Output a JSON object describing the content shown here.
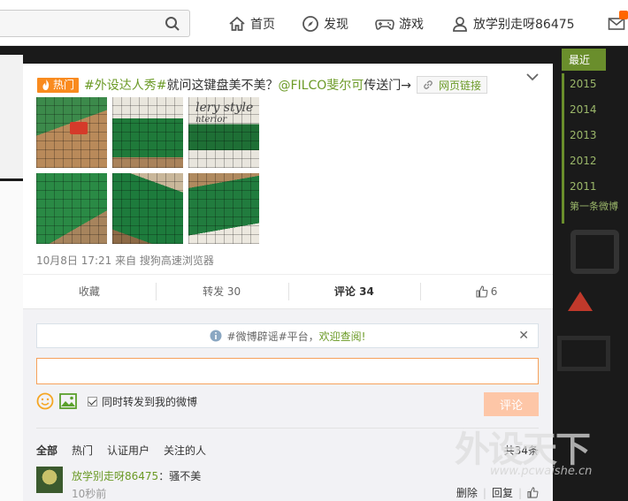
{
  "header": {
    "nav": {
      "home": "首页",
      "discover": "发现",
      "game": "游戏",
      "username": "放学别走呀86475"
    }
  },
  "post": {
    "hot_label": "热门",
    "topic": "#外设达人秀#",
    "text": " 就问这键盘美不美？",
    "mention": "@FILCO斐尔可",
    "portal": " 传送门→",
    "link_label": "网页链接",
    "image_text": "lery style",
    "image_subtext": "nterior",
    "meta": "10月8日 17:21 来自 搜狗高速浏览器"
  },
  "actions": {
    "favorite": "收藏",
    "repost": "转发 30",
    "comment": "评论 34",
    "like": "6"
  },
  "comment_box": {
    "notice_prefix": "#微博辟谣#平台，",
    "notice_link": "欢迎查阅!",
    "input_value": "",
    "sync_label": "同时转发到我的微博",
    "submit": "评论"
  },
  "comments": {
    "filters": [
      "全部",
      "热门",
      "认证用户",
      "关注的人"
    ],
    "total": "共34条",
    "items": [
      {
        "author": "放学别走呀86475",
        "text": "：骚不美",
        "time": "10秒前",
        "delete": "删除",
        "reply": "回复"
      }
    ]
  },
  "timeline": {
    "latest": "最近",
    "years": [
      "2015",
      "2014",
      "2013",
      "2012",
      "2011"
    ],
    "first": "第一条微博"
  },
  "watermark": {
    "brand": "外设天下",
    "url": "www.pcwaishe.cn"
  },
  "colors": {
    "accent_green": "#6b9a26",
    "hot_orange": "#f98b1f",
    "input_border": "#f6a15b",
    "timeline_green": "#6a8e2c"
  }
}
